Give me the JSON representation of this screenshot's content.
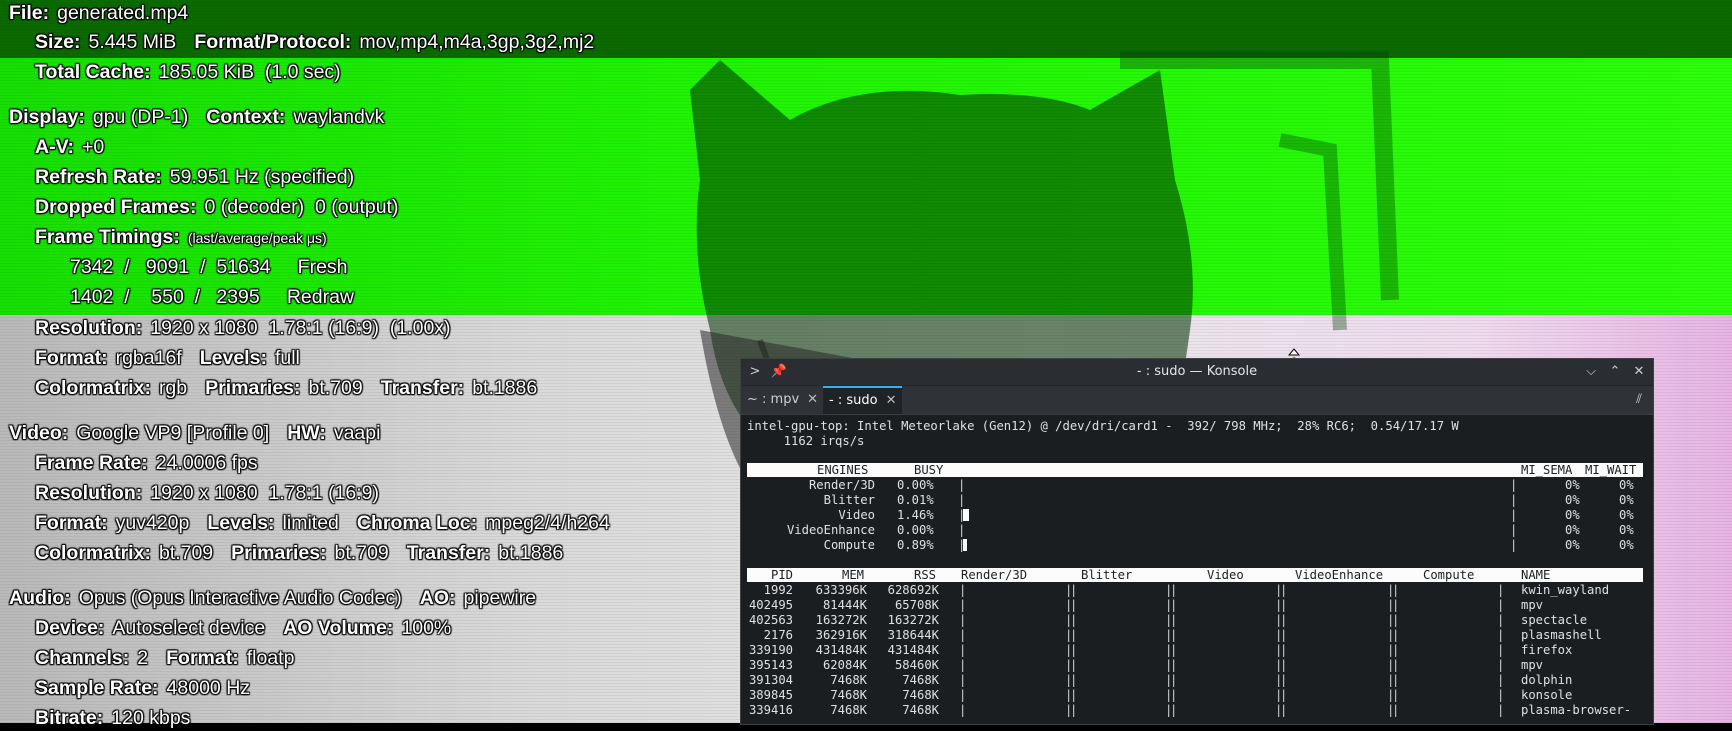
{
  "osd": {
    "file_label": "File:",
    "file_value": "generated.mp4",
    "size_label": "Size:",
    "size_value": "5.445 MiB",
    "format_protocol_label": "Format/Protocol:",
    "format_protocol_value": "mov,mp4,m4a,3gp,3g2,mj2",
    "total_cache_label": "Total Cache:",
    "total_cache_value": "185.05 KiB  (1.0 sec)",
    "display_label": "Display:",
    "display_value": "gpu (DP-1)",
    "context_label": "Context:",
    "context_value": "waylandvk",
    "av_label": "A-V:",
    "av_value": "+0",
    "refresh_label": "Refresh Rate:",
    "refresh_value": "59.951 Hz (specified)",
    "dropped_label": "Dropped Frames:",
    "dropped_value": "0 (decoder)  0 (output)",
    "timings_label": "Frame Timings:",
    "timings_unit": "(last/average/peak μs)",
    "timing_fresh": "7342  /   9091  /  51634     Fresh",
    "timing_redraw": "1402  /    550  /   2395     Redraw",
    "disp_res_label": "Resolution:",
    "disp_res_value": "1920 x 1080  1.78:1 (16:9)  (1.00x)",
    "disp_format_label": "Format:",
    "disp_format_value": "rgba16f",
    "disp_levels_label": "Levels:",
    "disp_levels_value": "full",
    "disp_cm_label": "Colormatrix:",
    "disp_cm_value": "rgb",
    "disp_prim_label": "Primaries:",
    "disp_prim_value": "bt.709",
    "disp_trans_label": "Transfer:",
    "disp_trans_value": "bt.1886",
    "video_label": "Video:",
    "video_value": "Google VP9 [Profile 0]",
    "hw_label": "HW:",
    "hw_value": "vaapi",
    "fps_label": "Frame Rate:",
    "fps_value": "24.0006 fps",
    "vid_res_label": "Resolution:",
    "vid_res_value": "1920 x 1080  1.78:1 (16:9)",
    "vid_format_label": "Format:",
    "vid_format_value": "yuv420p",
    "vid_levels_label": "Levels:",
    "vid_levels_value": "limited",
    "chroma_label": "Chroma Loc:",
    "chroma_value": "mpeg2/4/h264",
    "vid_cm_label": "Colormatrix:",
    "vid_cm_value": "bt.709",
    "vid_prim_label": "Primaries:",
    "vid_prim_value": "bt.709",
    "vid_trans_label": "Transfer:",
    "vid_trans_value": "bt.1886",
    "audio_label": "Audio:",
    "audio_value": "Opus (Opus Interactive Audio Codec)",
    "ao_label": "AO:",
    "ao_value": "pipewire",
    "device_label": "Device:",
    "device_value": "Autoselect device",
    "ao_vol_label": "AO Volume:",
    "ao_vol_value": "100%",
    "channels_label": "Channels:",
    "channels_value": "2",
    "aud_format_label": "Format:",
    "aud_format_value": "floatp",
    "sample_label": "Sample Rate:",
    "sample_value": "48000 Hz",
    "bitrate_label": "Bitrate:",
    "bitrate_value": "120 kbps"
  },
  "konsole": {
    "title": "- : sudo — Konsole",
    "tabs": [
      {
        "label": "~ : mpv",
        "close": "✕"
      },
      {
        "label": "- : sudo",
        "close": "✕"
      }
    ],
    "header_line1": "intel-gpu-top: Intel Meteorlake (Gen12) @ /dev/dri/card1 -  392/ 798 MHz;  28% RC6;  0.54/17.17 W",
    "header_line2": "     1162 irqs/s",
    "engine_cols": {
      "engines": "ENGINES",
      "busy": "BUSY",
      "mi_sema": "MI_SEMA",
      "mi_wait": "MI_WAIT"
    },
    "engines": [
      {
        "name": "Render/3D",
        "busy": "0.00%",
        "busy_level": 0.0,
        "sema": "0%",
        "wait": "0%"
      },
      {
        "name": "Blitter",
        "busy": "0.01%",
        "busy_level": 0.0001,
        "sema": "0%",
        "wait": "0%"
      },
      {
        "name": "Video",
        "busy": "1.46%",
        "busy_level": 0.0146,
        "sema": "0%",
        "wait": "0%"
      },
      {
        "name": "VideoEnhance",
        "busy": "0.00%",
        "busy_level": 0.0,
        "sema": "0%",
        "wait": "0%"
      },
      {
        "name": "Compute",
        "busy": "0.89%",
        "busy_level": 0.0089,
        "sema": "0%",
        "wait": "0%"
      }
    ],
    "proc_cols": {
      "pid": "PID",
      "mem": "MEM",
      "rss": "RSS",
      "render": "Render/3D",
      "blitter": "Blitter",
      "video": "Video",
      "ve": "VideoEnhance",
      "compute": "Compute",
      "name": "NAME"
    },
    "processes": [
      {
        "pid": "1992",
        "mem": "633396K",
        "rss": "628692K",
        "name": "kwin_wayland"
      },
      {
        "pid": "402495",
        "mem": "81444K",
        "rss": "65708K",
        "name": "mpv"
      },
      {
        "pid": "402563",
        "mem": "163272K",
        "rss": "163272K",
        "name": "spectacle"
      },
      {
        "pid": "2176",
        "mem": "362916K",
        "rss": "318644K",
        "name": "plasmashell"
      },
      {
        "pid": "339190",
        "mem": "431484K",
        "rss": "431484K",
        "name": "firefox"
      },
      {
        "pid": "395143",
        "mem": "62084K",
        "rss": "58460K",
        "name": "mpv"
      },
      {
        "pid": "391304",
        "mem": "7468K",
        "rss": "7468K",
        "name": "dolphin"
      },
      {
        "pid": "389845",
        "mem": "7468K",
        "rss": "7468K",
        "name": "konsole"
      },
      {
        "pid": "339416",
        "mem": "7468K",
        "rss": "7468K",
        "name": "plasma-browser-"
      }
    ]
  }
}
